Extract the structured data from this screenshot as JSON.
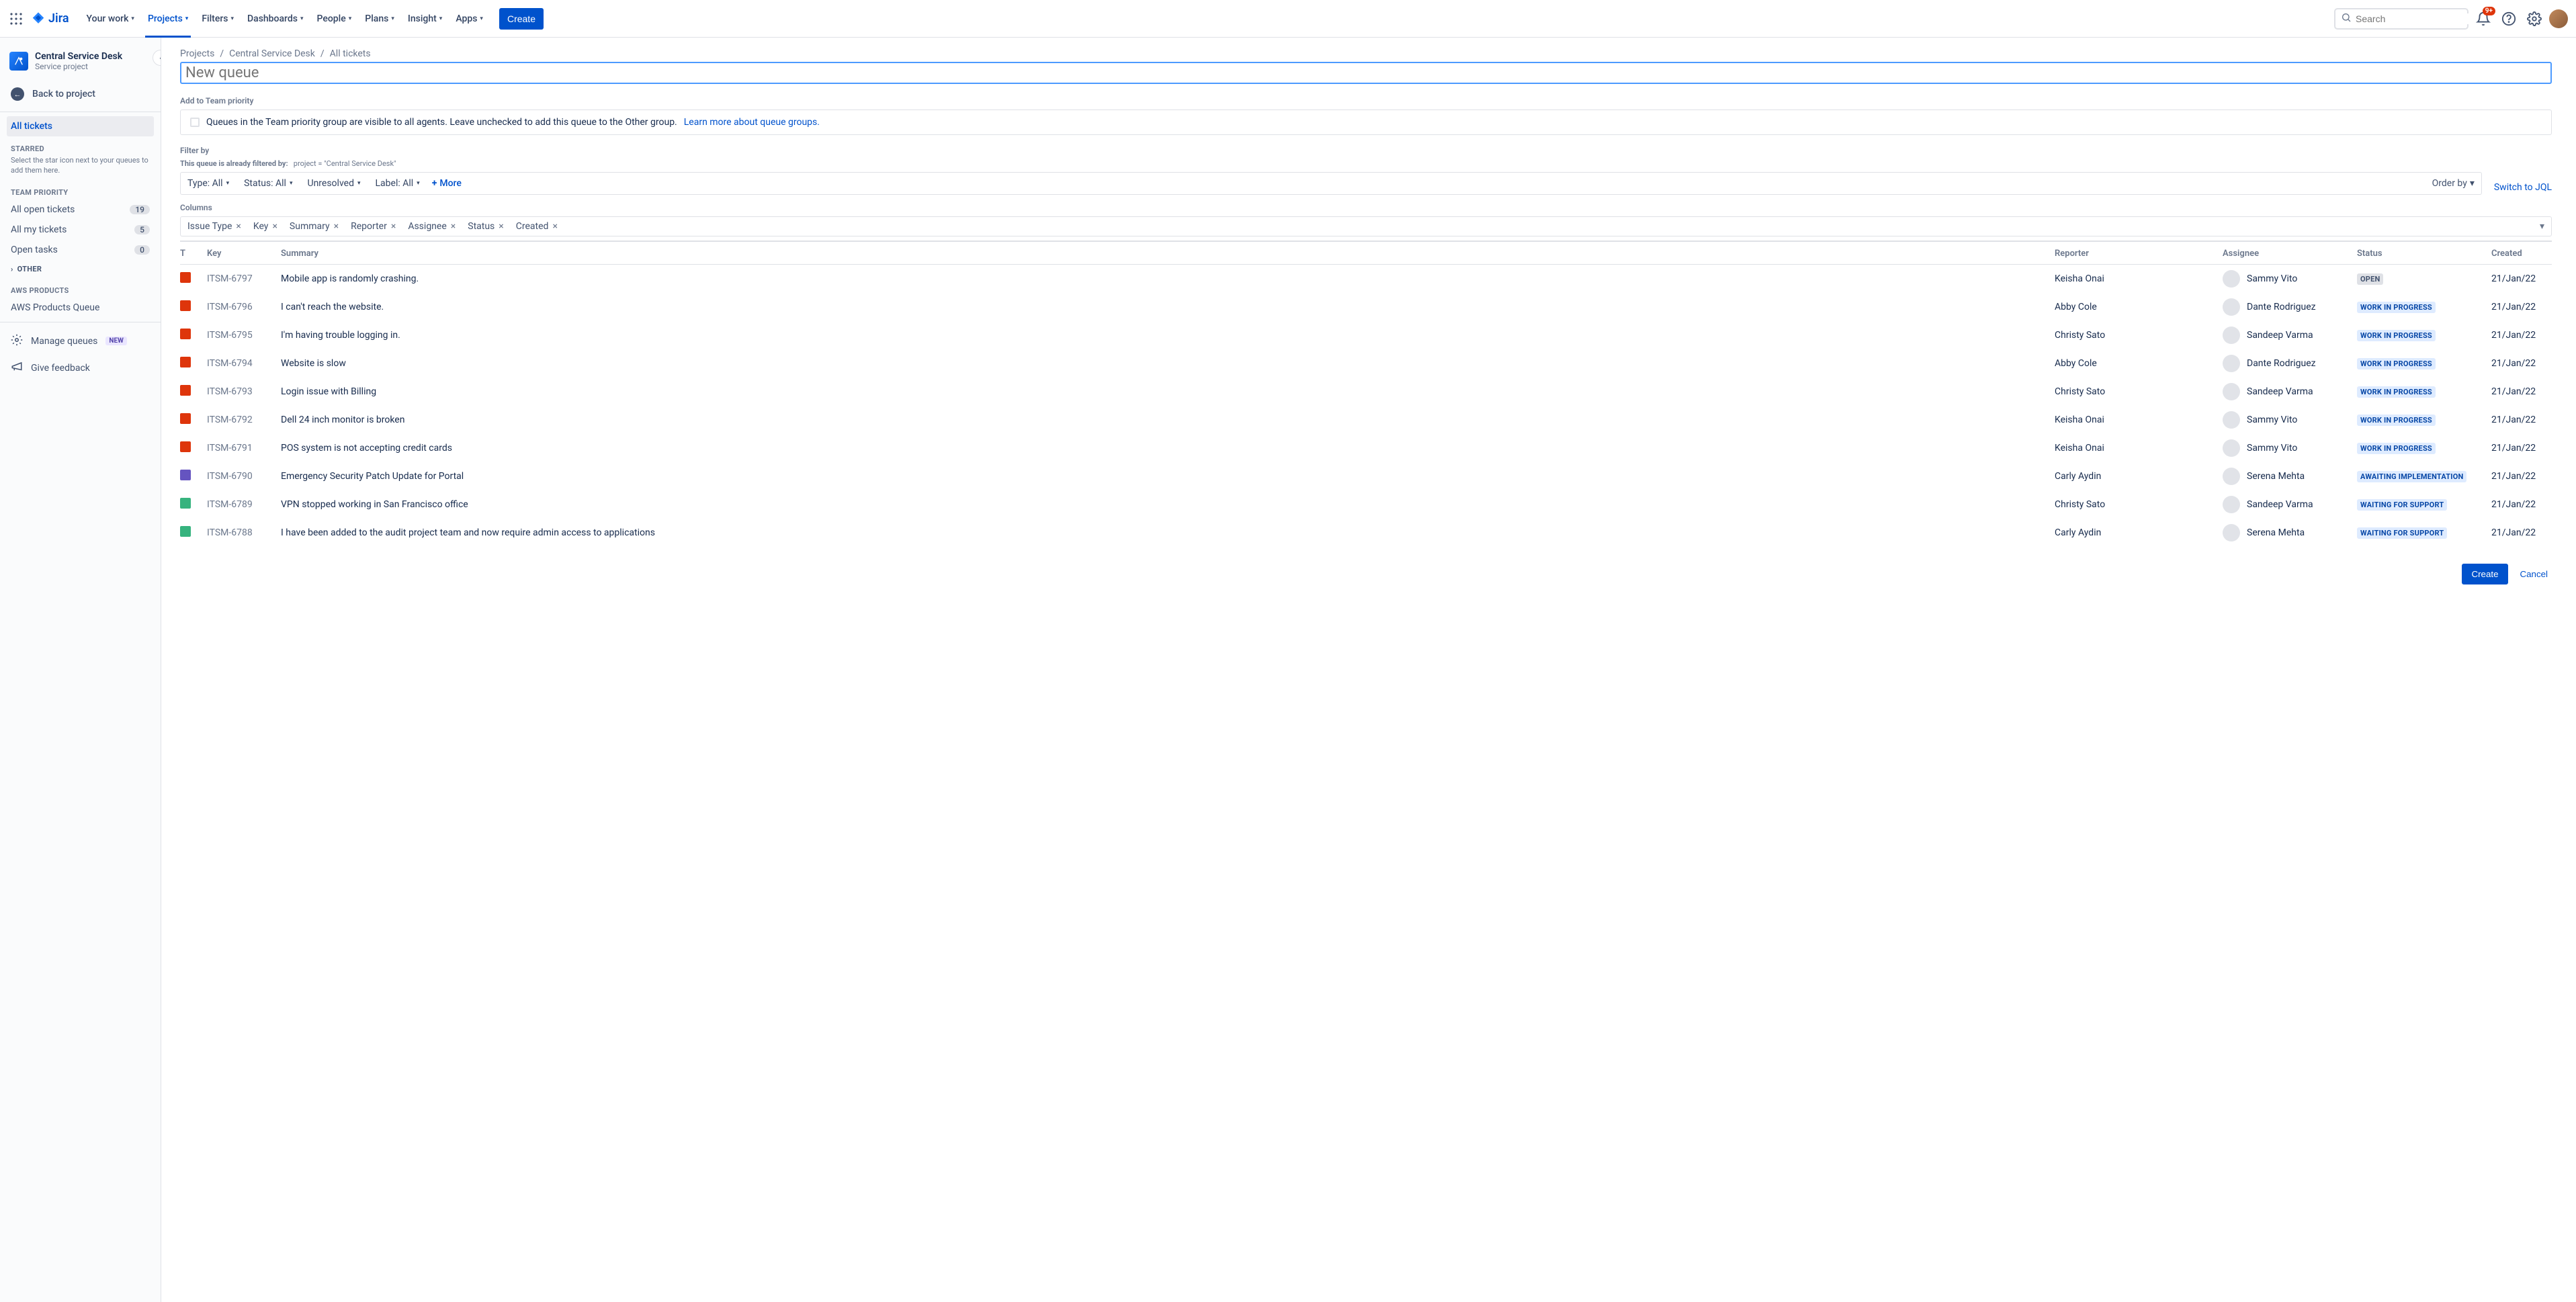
{
  "topnav": {
    "product": "Jira",
    "items": [
      "Your work",
      "Projects",
      "Filters",
      "Dashboards",
      "People",
      "Plans",
      "Insight",
      "Apps"
    ],
    "active_index": 1,
    "create": "Create",
    "search_placeholder": "Search",
    "notif_badge": "9+"
  },
  "sidebar": {
    "project_title": "Central Service Desk",
    "project_sub": "Service project",
    "back": "Back to project",
    "all_tickets": "All tickets",
    "starred_heading": "STARRED",
    "starred_hint": "Select the star icon next to your queues to add them here.",
    "team_heading": "TEAM PRIORITY",
    "team_items": [
      {
        "label": "All open tickets",
        "count": "19"
      },
      {
        "label": "All my tickets",
        "count": "5"
      },
      {
        "label": "Open tasks",
        "count": "0"
      }
    ],
    "other": "OTHER",
    "aws_heading": "AWS PRODUCTS",
    "aws_item": "AWS Products Queue",
    "manage_queues": "Manage queues",
    "new_badge": "NEW",
    "feedback": "Give feedback"
  },
  "breadcrumbs": [
    "Projects",
    "Central Service Desk",
    "All tickets"
  ],
  "queue_name_placeholder": "New queue",
  "team_priority": {
    "label": "Add to Team priority",
    "text": "Queues in the Team priority group are visible to all agents. Leave unchecked to add this queue to the Other group.",
    "link": "Learn more about queue groups."
  },
  "filter": {
    "label": "Filter by",
    "hint_prefix": "This queue is already filtered by:",
    "hint_query": "project = \"Central Service Desk\"",
    "chips": [
      "Type: All",
      "Status: All",
      "Unresolved",
      "Label: All"
    ],
    "more": "More",
    "order_by": "Order by",
    "jql": "Switch to JQL"
  },
  "columns": {
    "label": "Columns",
    "chips": [
      "Issue Type",
      "Key",
      "Summary",
      "Reporter",
      "Assignee",
      "Status",
      "Created"
    ]
  },
  "table": {
    "headers": {
      "t": "T",
      "key": "Key",
      "summary": "Summary",
      "reporter": "Reporter",
      "assignee": "Assignee",
      "status": "Status",
      "created": "Created"
    },
    "rows": [
      {
        "type": "red",
        "key": "ITSM-6797",
        "summary": "Mobile app is randomly crashing.",
        "reporter": "Keisha Onai",
        "assignee": "Sammy Vito",
        "status": "OPEN",
        "status_class": "st-open",
        "created": "21/Jan/22"
      },
      {
        "type": "red",
        "key": "ITSM-6796",
        "summary": "I can't reach the website.",
        "reporter": "Abby Cole",
        "assignee": "Dante Rodriguez",
        "status": "WORK IN PROGRESS",
        "status_class": "st-wip",
        "created": "21/Jan/22"
      },
      {
        "type": "red",
        "key": "ITSM-6795",
        "summary": "I'm having trouble logging in.",
        "reporter": "Christy Sato",
        "assignee": "Sandeep Varma",
        "status": "WORK IN PROGRESS",
        "status_class": "st-wip",
        "created": "21/Jan/22"
      },
      {
        "type": "red",
        "key": "ITSM-6794",
        "summary": "Website is slow",
        "reporter": "Abby Cole",
        "assignee": "Dante Rodriguez",
        "status": "WORK IN PROGRESS",
        "status_class": "st-wip",
        "created": "21/Jan/22"
      },
      {
        "type": "red",
        "key": "ITSM-6793",
        "summary": "Login issue with Billing",
        "reporter": "Christy Sato",
        "assignee": "Sandeep Varma",
        "status": "WORK IN PROGRESS",
        "status_class": "st-wip",
        "created": "21/Jan/22"
      },
      {
        "type": "red",
        "key": "ITSM-6792",
        "summary": "Dell 24 inch monitor is broken",
        "reporter": "Keisha Onai",
        "assignee": "Sammy Vito",
        "status": "WORK IN PROGRESS",
        "status_class": "st-wip",
        "created": "21/Jan/22"
      },
      {
        "type": "red",
        "key": "ITSM-6791",
        "summary": "POS system is not accepting credit cards",
        "reporter": "Keisha Onai",
        "assignee": "Sammy Vito",
        "status": "WORK IN PROGRESS",
        "status_class": "st-wip",
        "created": "21/Jan/22"
      },
      {
        "type": "purple",
        "key": "ITSM-6790",
        "summary": "Emergency Security Patch Update for Portal",
        "reporter": "Carly Aydin",
        "assignee": "Serena Mehta",
        "status": "AWAITING IMPLEMENTATION",
        "status_class": "st-ai",
        "created": "21/Jan/22"
      },
      {
        "type": "green",
        "key": "ITSM-6789",
        "summary": "VPN stopped working in San Francisco office",
        "reporter": "Christy Sato",
        "assignee": "Sandeep Varma",
        "status": "WAITING FOR SUPPORT",
        "status_class": "st-wfs",
        "created": "21/Jan/22"
      },
      {
        "type": "green",
        "key": "ITSM-6788",
        "summary": "I have been added to the audit project team and now require admin access to applications",
        "reporter": "Carly Aydin",
        "assignee": "Serena Mehta",
        "status": "WAITING FOR SUPPORT",
        "status_class": "st-wfs",
        "created": "21/Jan/22"
      }
    ]
  },
  "footer": {
    "create": "Create",
    "cancel": "Cancel"
  }
}
